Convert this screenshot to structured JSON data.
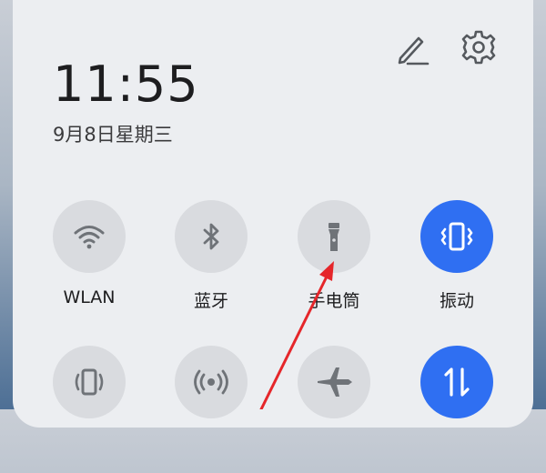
{
  "status": {
    "time": "11:55",
    "date": "9月8日星期三"
  },
  "header": {
    "edit_icon": "edit-pencil-icon",
    "settings_icon": "gear-icon"
  },
  "tiles_row1": [
    {
      "label": "WLAN",
      "icon": "wifi-icon",
      "active": false
    },
    {
      "label": "蓝牙",
      "icon": "bluetooth-icon",
      "active": false
    },
    {
      "label": "手电筒",
      "icon": "flashlight-icon",
      "active": false
    },
    {
      "label": "振动",
      "icon": "vibrate-icon",
      "active": true
    }
  ],
  "tiles_row2": [
    {
      "icon": "screen-rotate-icon",
      "active": false
    },
    {
      "icon": "hotspot-icon",
      "active": false
    },
    {
      "icon": "airplane-icon",
      "active": false
    },
    {
      "icon": "mobile-data-icon",
      "active": true
    }
  ],
  "colors": {
    "accent": "#2f6ff2",
    "tile_bg": "#d9dbdf",
    "icon_gray": "#6f7378",
    "arrow": "#e5262a"
  }
}
